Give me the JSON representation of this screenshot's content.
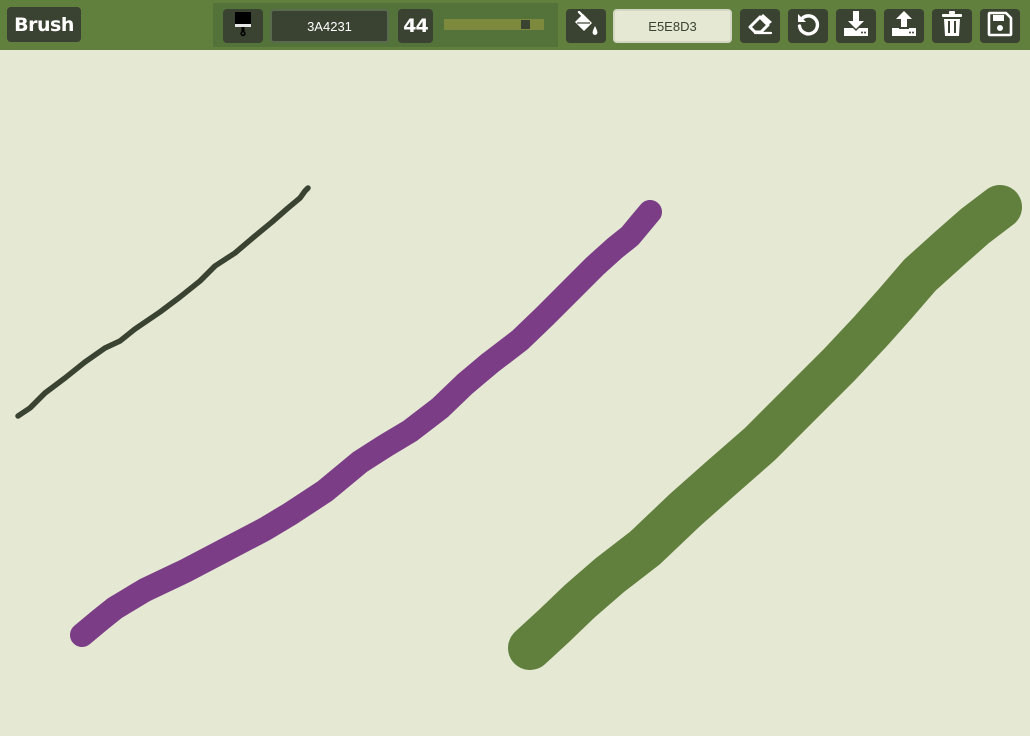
{
  "toolbar": {
    "tool_label": "Brush",
    "brush_color": "3A4231",
    "brush_size": "44",
    "brush_size_level": 0.85,
    "background_color": "E5E8D3"
  },
  "icons": {
    "brush": "paint-brush-icon",
    "fill": "paint-bucket-icon",
    "eraser": "eraser-icon",
    "undo": "undo-icon",
    "download": "download-icon",
    "upload": "upload-icon",
    "clear": "trash-icon",
    "save": "floppy-disk-icon"
  },
  "colors": {
    "toolbar_bg": "#617F3D",
    "button_bg": "#3A4231",
    "canvas_bg": "#E5E8D3",
    "stroke_dark": "#3A4231",
    "stroke_purple": "#7A3D86",
    "stroke_green": "#617F3D"
  }
}
